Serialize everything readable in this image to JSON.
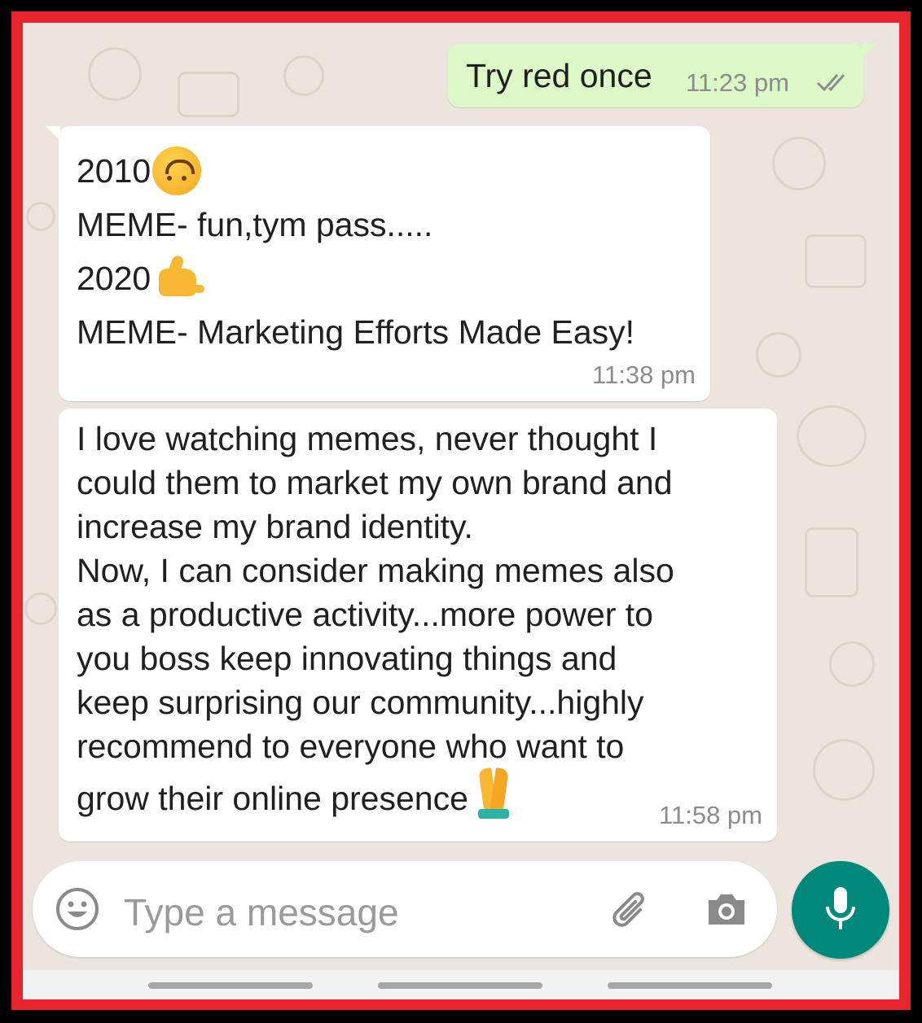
{
  "chat": {
    "messages": [
      {
        "direction": "outgoing",
        "text": "Try red once",
        "time": "11:23 pm",
        "status_icon": "double-check-icon"
      },
      {
        "direction": "incoming",
        "lines": [
          {
            "text": "2010",
            "emoji": "upside-down-face-emoji"
          },
          {
            "text": "MEME- fun,tym pass....."
          },
          {
            "text": "2020",
            "emoji": "call-me-hand-emoji"
          },
          {
            "text": "MEME- Marketing Efforts Made Easy!"
          }
        ],
        "time": "11:38 pm"
      },
      {
        "direction": "incoming",
        "text": "I love watching memes, never thought I\ncould them to market my own brand and\nincrease my brand identity.\nNow, I can consider making memes also\nas a productive activity...more power to\nyou boss keep innovating things and\nkeep surprising our community...highly\nrecommend to everyone who want to\ngrow their online presence",
        "emoji": "folded-hands-emoji",
        "time": "11:58 pm"
      }
    ]
  },
  "composer": {
    "placeholder": "Type a message",
    "icons": [
      "emoji-icon",
      "attach-icon",
      "camera-icon",
      "microphone-icon"
    ]
  },
  "colors": {
    "frame_border": "#e8242f",
    "outgoing_bubble": "#dcf8c6",
    "incoming_bubble": "#ffffff",
    "wallpaper": "#ece5dd",
    "mic_button": "#00897b"
  }
}
